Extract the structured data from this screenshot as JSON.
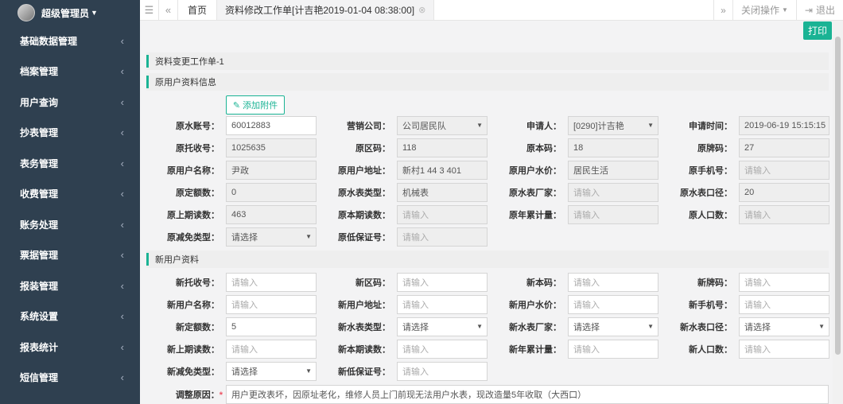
{
  "sidebar": {
    "profile_name": "超级管理员",
    "items": [
      {
        "label": "基础数据管理"
      },
      {
        "label": "档案管理"
      },
      {
        "label": "用户查询"
      },
      {
        "label": "抄表管理"
      },
      {
        "label": "表务管理"
      },
      {
        "label": "收费管理"
      },
      {
        "label": "账务处理"
      },
      {
        "label": "票据管理"
      },
      {
        "label": "报装管理"
      },
      {
        "label": "系统设置"
      },
      {
        "label": "报表统计"
      },
      {
        "label": "短信管理"
      }
    ]
  },
  "topbar": {
    "home_tab": "首页",
    "active_tab": "资料修改工作单[计吉艳2019-01-04 08:38:00]",
    "close_ops": "关闭操作",
    "logout": "退出"
  },
  "main": {
    "print_label": "打印",
    "section_title": "资料变更工作单-1",
    "section_old": "原用户资料信息",
    "attach_label": "添加附件",
    "section_new": "新用户资料",
    "old_rows": [
      [
        {
          "label": "原水账号：",
          "value": "60012883",
          "style": "normal"
        },
        {
          "label": "营销公司：",
          "value": "公司居民队",
          "style": "select-ro"
        },
        {
          "label": "申请人：",
          "value": "[0290]计吉艳",
          "style": "select-ro"
        },
        {
          "label": "申请时间：",
          "value": "2019-06-19 15:15:15",
          "style": "ro"
        }
      ],
      [
        {
          "label": "原托收号：",
          "value": "1025635",
          "style": "ro"
        },
        {
          "label": "原区码：",
          "value": "118",
          "style": "ro"
        },
        {
          "label": "原本码：",
          "value": "18",
          "style": "ro"
        },
        {
          "label": "原牌码：",
          "value": "27",
          "style": "ro"
        }
      ],
      [
        {
          "label": "原用户名称：",
          "value": "尹政",
          "style": "ro"
        },
        {
          "label": "原用户地址：",
          "value": "新村1 44 3 401",
          "style": "ro"
        },
        {
          "label": "原用户水价：",
          "value": "居民生活",
          "style": "ro"
        },
        {
          "label": "原手机号：",
          "value": "请输入",
          "style": "ro-ph"
        }
      ],
      [
        {
          "label": "原定额数：",
          "value": "0",
          "style": "ro"
        },
        {
          "label": "原水表类型：",
          "value": "机械表",
          "style": "ro"
        },
        {
          "label": "原水表厂家：",
          "value": "请输入",
          "style": "ro-ph"
        },
        {
          "label": "原水表口径：",
          "value": "20",
          "style": "ro"
        }
      ],
      [
        {
          "label": "原上期读数：",
          "value": "463",
          "style": "ro"
        },
        {
          "label": "原本期读数：",
          "value": "请输入",
          "style": "ro-ph"
        },
        {
          "label": "原年累计量：",
          "value": "请输入",
          "style": "ro-ph"
        },
        {
          "label": "原人口数：",
          "value": "请输入",
          "style": "ro-ph"
        }
      ],
      [
        {
          "label": "原减免类型：",
          "value": "请选择",
          "style": "select-ro"
        },
        {
          "label": "原低保证号：",
          "value": "请输入",
          "style": "ro-ph"
        }
      ]
    ],
    "new_rows": [
      [
        {
          "label": "新托收号：",
          "value": "请输入",
          "style": "ph"
        },
        {
          "label": "新区码：",
          "value": "请输入",
          "style": "ph"
        },
        {
          "label": "新本码：",
          "value": "请输入",
          "style": "ph"
        },
        {
          "label": "新牌码：",
          "value": "请输入",
          "style": "ph"
        }
      ],
      [
        {
          "label": "新用户名称：",
          "value": "请输入",
          "style": "ph"
        },
        {
          "label": "新用户地址：",
          "value": "请输入",
          "style": "ph"
        },
        {
          "label": "新用户水价：",
          "value": "请输入",
          "style": "ph"
        },
        {
          "label": "新手机号：",
          "value": "请输入",
          "style": "ph"
        }
      ],
      [
        {
          "label": "新定额数：",
          "value": "5",
          "style": "normal"
        },
        {
          "label": "新水表类型：",
          "value": "请选择",
          "style": "select"
        },
        {
          "label": "新水表厂家：",
          "value": "请选择",
          "style": "select"
        },
        {
          "label": "新水表口径：",
          "value": "请选择",
          "style": "select"
        }
      ],
      [
        {
          "label": "新上期读数：",
          "value": "请输入",
          "style": "ph"
        },
        {
          "label": "新本期读数：",
          "value": "请输入",
          "style": "ph"
        },
        {
          "label": "新年累计量：",
          "value": "请输入",
          "style": "ph"
        },
        {
          "label": "新人口数：",
          "value": "请输入",
          "style": "ph"
        }
      ],
      [
        {
          "label": "新减免类型：",
          "value": "请选择",
          "style": "select"
        },
        {
          "label": "新低保证号：",
          "value": "请输入",
          "style": "ph"
        }
      ]
    ],
    "reason_label": "调整原因：",
    "reason_required": "*",
    "reason_value": "用户更改表坏，因原址老化，维修人员上门前现无法用户水表，现改造量5年收取（大西口）"
  }
}
